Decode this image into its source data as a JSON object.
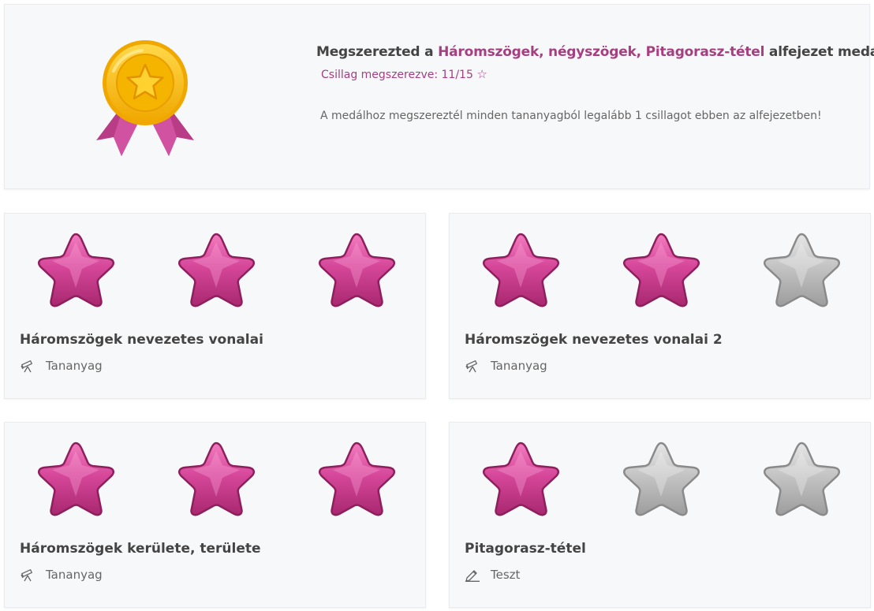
{
  "medal": {
    "title_before": "Megszerezted a ",
    "chapter_name": "Háromszögek, négyszögek, Pitagorasz-tétel",
    "title_after": " alfejezet medálját!",
    "stars_earned_label": "Csillag megszerezve: 11/15",
    "stars_earned_icon": "star-outline-icon",
    "description": "A medálhoz megszereztél minden tananyagból legalább 1 csillagot ebben az alfejezetben!",
    "medal_icon": "gold-medal-icon"
  },
  "colors": {
    "accent": "#a53f80",
    "star_filled": "#c6387f",
    "star_empty": "#bdbdbd",
    "medal_gold": "#f5b800",
    "ribbon": "#b93d86"
  },
  "cards": [
    {
      "title": "Háromszögek nevezetes vonalai",
      "type_label": "Tananyag",
      "type_icon": "telescope-icon",
      "stars_earned": 3,
      "stars_total": 3
    },
    {
      "title": "Háromszögek nevezetes vonalai 2",
      "type_label": "Tananyag",
      "type_icon": "telescope-icon",
      "stars_earned": 2,
      "stars_total": 3
    },
    {
      "title": "Háromszögek kerülete, területe",
      "type_label": "Tananyag",
      "type_icon": "telescope-icon",
      "stars_earned": 3,
      "stars_total": 3
    },
    {
      "title": "Pitagorasz-tétel",
      "type_label": "Teszt",
      "type_icon": "pencil-icon",
      "stars_earned": 1,
      "stars_total": 3
    }
  ]
}
